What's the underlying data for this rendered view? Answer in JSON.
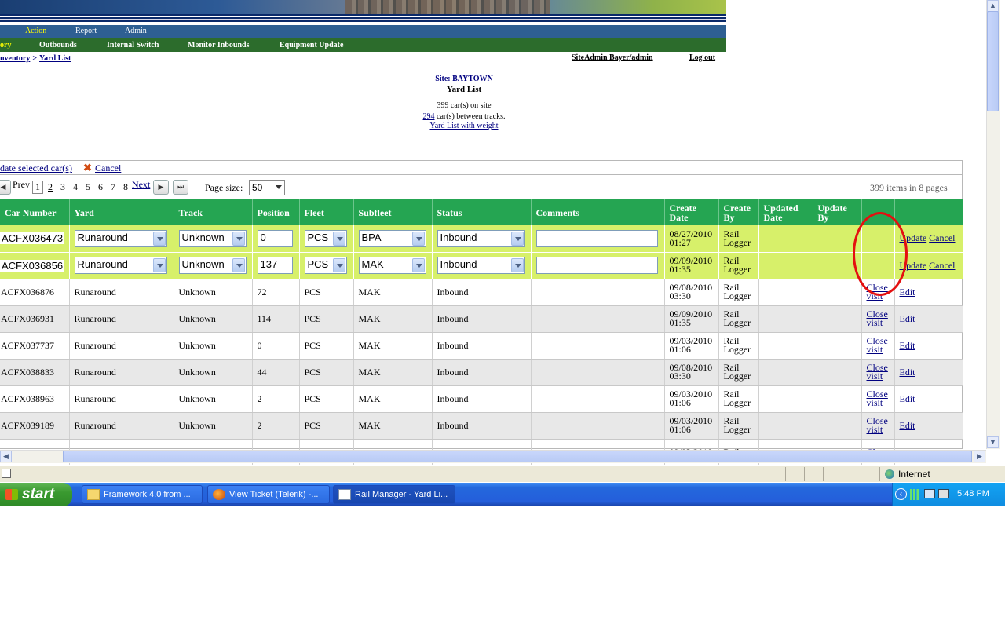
{
  "menu_top": [
    {
      "label": "Action",
      "active": true
    },
    {
      "label": "Report",
      "active": false
    },
    {
      "label": "Admin",
      "active": false
    }
  ],
  "menu_sub": [
    {
      "label": "ory",
      "active": true
    },
    {
      "label": "Outbounds",
      "active": false
    },
    {
      "label": "Internal Switch",
      "active": false
    },
    {
      "label": "Monitor Inbounds",
      "active": false
    },
    {
      "label": "Equipment Update",
      "active": false
    }
  ],
  "breadcrumb": {
    "first": "nventory",
    "sep": ">",
    "second": "Yard List"
  },
  "user": {
    "name": "SiteAdmin Bayer/admin",
    "logout": "Log out"
  },
  "site": {
    "title": "Site: BAYTOWN",
    "subtitle": "Yard List",
    "cars_on_site": "399 car(s) on site",
    "between_link": "294",
    "between_text": " car(s) between tracks.",
    "weight_link": "Yard List with weight"
  },
  "commands": {
    "update_selected": "date selected car(s)",
    "cancel": "Cancel"
  },
  "pager": {
    "prev": "Prev",
    "next": "Next",
    "pages": [
      "1",
      "2",
      "3",
      "4",
      "5",
      "6",
      "7",
      "8"
    ],
    "current": "1",
    "page_size_label": "Page size:",
    "page_size_value": "50",
    "summary": "399 items in 8 pages"
  },
  "columns": [
    "Car Number",
    "Yard",
    "Track",
    "Position",
    "Fleet",
    "Subfleet",
    "Status",
    "Comments",
    "Create Date",
    "Create By",
    "Updated Date",
    "Update By",
    "",
    ""
  ],
  "edit_rows": [
    {
      "car": "ACFX036473",
      "yard": "Runaround",
      "track": "Unknown",
      "position": "0",
      "fleet": "PCS",
      "subfleet": "BPA",
      "status": "Inbound",
      "comments": "",
      "create_date": "08/27/2010 01:27",
      "create_by": "Rail Logger",
      "update_label": "Update",
      "cancel_label": "Cancel"
    },
    {
      "car": "ACFX036856",
      "yard": "Runaround",
      "track": "Unknown",
      "position": "137",
      "fleet": "PCS",
      "subfleet": "MAK",
      "status": "Inbound",
      "comments": "",
      "create_date": "09/09/2010 01:35",
      "create_by": "Rail Logger",
      "update_label": "Update",
      "cancel_label": "Cancel"
    }
  ],
  "rows": [
    {
      "car": "ACFX036876",
      "yard": "Runaround",
      "track": "Unknown",
      "position": "72",
      "fleet": "PCS",
      "subfleet": "MAK",
      "status": "Inbound",
      "create_date": "09/08/2010 03:30",
      "create_by": "Rail Logger",
      "close": "Close visit",
      "edit": "Edit"
    },
    {
      "car": "ACFX036931",
      "yard": "Runaround",
      "track": "Unknown",
      "position": "114",
      "fleet": "PCS",
      "subfleet": "MAK",
      "status": "Inbound",
      "create_date": "09/09/2010 01:35",
      "create_by": "Rail Logger",
      "close": "Close visit",
      "edit": "Edit"
    },
    {
      "car": "ACFX037737",
      "yard": "Runaround",
      "track": "Unknown",
      "position": "0",
      "fleet": "PCS",
      "subfleet": "MAK",
      "status": "Inbound",
      "create_date": "09/03/2010 01:06",
      "create_by": "Rail Logger",
      "close": "Close visit",
      "edit": "Edit"
    },
    {
      "car": "ACFX038833",
      "yard": "Runaround",
      "track": "Unknown",
      "position": "44",
      "fleet": "PCS",
      "subfleet": "MAK",
      "status": "Inbound",
      "create_date": "09/08/2010 03:30",
      "create_by": "Rail Logger",
      "close": "Close visit",
      "edit": "Edit"
    },
    {
      "car": "ACFX038963",
      "yard": "Runaround",
      "track": "Unknown",
      "position": "2",
      "fleet": "PCS",
      "subfleet": "MAK",
      "status": "Inbound",
      "create_date": "09/03/2010 01:06",
      "create_by": "Rail Logger",
      "close": "Close visit",
      "edit": "Edit"
    },
    {
      "car": "ACFX039189",
      "yard": "Runaround",
      "track": "Unknown",
      "position": "2",
      "fleet": "PCS",
      "subfleet": "MAK",
      "status": "Inbound",
      "create_date": "09/03/2010 01:06",
      "create_by": "Rail Logger",
      "close": "Close visit",
      "edit": "Edit"
    },
    {
      "car": "",
      "yard": "",
      "track": "",
      "position": "",
      "fleet": "",
      "subfleet": "",
      "status": "",
      "create_date": "09/03/2010",
      "create_by": "Rail",
      "close": "Close",
      "edit": ""
    }
  ],
  "statusbar": {
    "zone": "Internet"
  },
  "taskbar": {
    "start": "start",
    "tasks": [
      {
        "label": "Framework 4.0 from ...",
        "icon": "folder-icon"
      },
      {
        "label": "View Ticket (Telerik) -...",
        "icon": "firefox-icon"
      },
      {
        "label": "Rail Manager - Yard Li...",
        "icon": "ie-icon",
        "active": true
      }
    ],
    "clock": "5:48 PM"
  },
  "colors": {
    "grid_header": "#25a552",
    "edit_row": "#d7f06a",
    "menu_blue": "#2e5f92",
    "menu_green": "#2c6c2c",
    "annotation": "#e41010"
  }
}
